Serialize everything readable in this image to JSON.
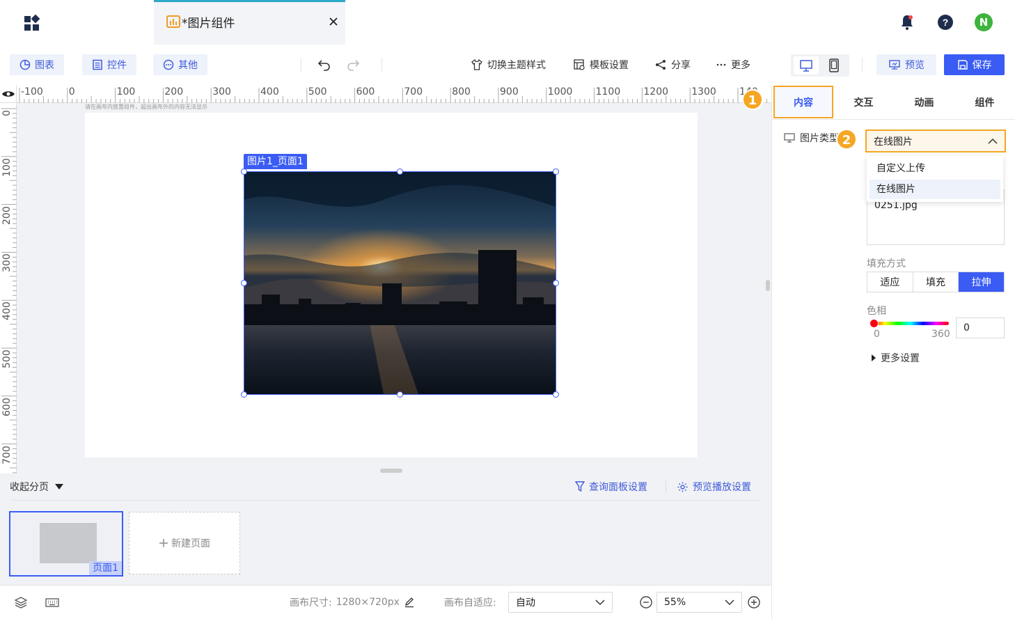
{
  "header": {
    "tab_title": "*图片组件"
  },
  "avatar_initial": "N",
  "toolbar": {
    "chart_btn": "图表",
    "control_btn": "控件",
    "other_btn": "其他",
    "theme": "切换主题样式",
    "template": "模板设置",
    "share": "分享",
    "more": "更多",
    "preview": "预览",
    "save": "保存"
  },
  "ruler": {
    "h_labels": [
      "-100",
      "0",
      "100",
      "200",
      "300",
      "400",
      "500",
      "600",
      "700",
      "800",
      "900",
      "1000",
      "1100",
      "1200",
      "1300",
      "140"
    ],
    "v_labels": [
      "0",
      "100",
      "200",
      "300",
      "400",
      "500",
      "600",
      "700"
    ]
  },
  "canvas": {
    "hint": "请在画布内放置组件，超出画布外的内容无法显示",
    "image_label": "图片1_页面1"
  },
  "pages": {
    "collapse": "收起分页",
    "query_settings": "查询面板设置",
    "play_settings": "预览播放设置",
    "page1_label": "页面1",
    "new_page": "新建页面"
  },
  "status": {
    "canvas_size_label": "画布尺寸:",
    "canvas_size_value": "1280×720px",
    "auto_label": "画布自适应:",
    "auto_value": "自动",
    "zoom_value": "55%"
  },
  "right_panel": {
    "tabs": [
      "内容",
      "交互",
      "动画",
      "组件"
    ],
    "badge1": "1",
    "badge2": "2",
    "image_type_label": "图片类型",
    "image_type_value": "在线图片",
    "dropdown": [
      "自定义上传",
      "在线图片"
    ],
    "url_value": "0251.jpg",
    "fill_label": "填充方式",
    "fill_options": [
      "适应",
      "填充",
      "拉伸"
    ],
    "hue_label": "色相",
    "hue_min": "0",
    "hue_max": "360",
    "hue_value": "0",
    "more_settings": "更多设置"
  },
  "colors": {
    "accent": "#3a5cf4",
    "highlight": "#f5a623",
    "tab_indicator": "#2ea8c7"
  }
}
